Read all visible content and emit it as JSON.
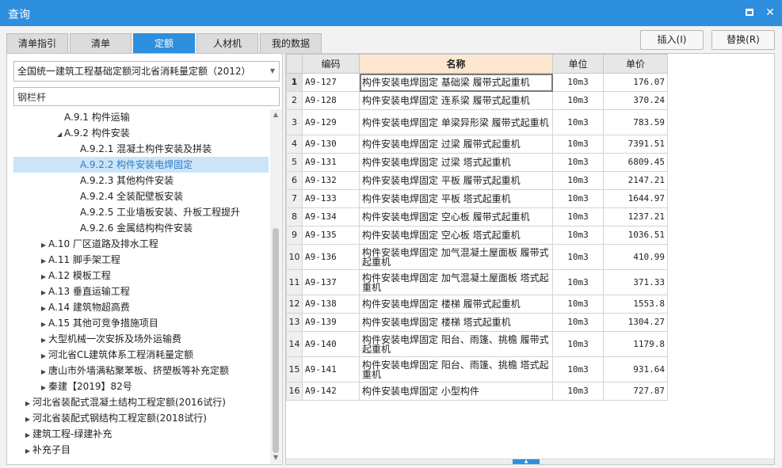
{
  "window": {
    "title": "查询"
  },
  "tabs": [
    {
      "label": "清单指引",
      "active": false
    },
    {
      "label": "清单",
      "active": false
    },
    {
      "label": "定额",
      "active": true
    },
    {
      "label": "人材机",
      "active": false
    },
    {
      "label": "我的数据",
      "active": false
    }
  ],
  "actions": {
    "insert_label": "插入(I)",
    "replace_label": "替换(R)"
  },
  "left": {
    "library_select": "全国统一建筑工程基础定额河北省消耗量定额（2012）",
    "search_value": "钢栏杆",
    "tree": [
      {
        "label": "A.9.1 构件运输",
        "toggle": "",
        "level": 2
      },
      {
        "label": "A.9.2 构件安装",
        "toggle": "◢",
        "level": 2
      },
      {
        "label": "A.9.2.1 混凝土构件安装及拼装",
        "toggle": "",
        "level": 3
      },
      {
        "label": "A.9.2.2 构件安装电焊固定",
        "toggle": "",
        "level": 3,
        "selected": true
      },
      {
        "label": "A.9.2.3 其他构件安装",
        "toggle": "",
        "level": 3
      },
      {
        "label": "A.9.2.4 全装配壁板安装",
        "toggle": "",
        "level": 3
      },
      {
        "label": "A.9.2.5 工业墙板安装、升板工程提升",
        "toggle": "",
        "level": 3
      },
      {
        "label": "A.9.2.6 金属结构构件安装",
        "toggle": "",
        "level": 3
      },
      {
        "label": "A.10 厂区道路及排水工程",
        "toggle": "▶",
        "level": 1
      },
      {
        "label": "A.11 脚手架工程",
        "toggle": "▶",
        "level": 1
      },
      {
        "label": "A.12 模板工程",
        "toggle": "▶",
        "level": 1
      },
      {
        "label": "A.13 垂直运输工程",
        "toggle": "▶",
        "level": 1
      },
      {
        "label": "A.14 建筑物超高费",
        "toggle": "▶",
        "level": 1
      },
      {
        "label": "A.15 其他可竞争措施项目",
        "toggle": "▶",
        "level": 1
      },
      {
        "label": "大型机械一次安拆及场外运输费",
        "toggle": "▶",
        "level": 1
      },
      {
        "label": "河北省CL建筑体系工程消耗量定额",
        "toggle": "▶",
        "level": 1
      },
      {
        "label": "唐山市外墙满粘聚苯板、挤塑板等补充定额",
        "toggle": "▶",
        "level": 1
      },
      {
        "label": "秦建【2019】82号",
        "toggle": "▶",
        "level": 1
      },
      {
        "label": "河北省装配式混凝土结构工程定额(2016试行)",
        "toggle": "▶",
        "level": 0
      },
      {
        "label": "河北省装配式钢结构工程定额(2018试行)",
        "toggle": "▶",
        "level": 0
      },
      {
        "label": "建筑工程-绿建补充",
        "toggle": "▶",
        "level": 0
      },
      {
        "label": "补充子目",
        "toggle": "▶",
        "level": 0
      }
    ]
  },
  "grid": {
    "headers": {
      "code": "编码",
      "name": "名称",
      "unit": "单位",
      "price": "单价"
    },
    "rows": [
      {
        "no": "1",
        "code": "A9-127",
        "name": "构件安装电焊固定 基础梁 履带式起重机",
        "unit": "10m3",
        "price": "176.07"
      },
      {
        "no": "2",
        "code": "A9-128",
        "name": "构件安装电焊固定 连系梁 履带式起重机",
        "unit": "10m3",
        "price": "370.24"
      },
      {
        "no": "3",
        "code": "A9-129",
        "name": "构件安装电焊固定 单梁异形梁 履带式起重机",
        "unit": "10m3",
        "price": "783.59"
      },
      {
        "no": "4",
        "code": "A9-130",
        "name": "构件安装电焊固定 过梁 履带式起重机",
        "unit": "10m3",
        "price": "7391.51"
      },
      {
        "no": "5",
        "code": "A9-131",
        "name": "构件安装电焊固定 过梁 塔式起重机",
        "unit": "10m3",
        "price": "6809.45"
      },
      {
        "no": "6",
        "code": "A9-132",
        "name": "构件安装电焊固定 平板 履带式起重机",
        "unit": "10m3",
        "price": "2147.21"
      },
      {
        "no": "7",
        "code": "A9-133",
        "name": "构件安装电焊固定 平板 塔式起重机",
        "unit": "10m3",
        "price": "1644.97"
      },
      {
        "no": "8",
        "code": "A9-134",
        "name": "构件安装电焊固定 空心板 履带式起重机",
        "unit": "10m3",
        "price": "1237.21"
      },
      {
        "no": "9",
        "code": "A9-135",
        "name": "构件安装电焊固定 空心板 塔式起重机",
        "unit": "10m3",
        "price": "1036.51"
      },
      {
        "no": "10",
        "code": "A9-136",
        "name": "构件安装电焊固定 加气混凝土屋面板 履带式起重机",
        "unit": "10m3",
        "price": "410.99"
      },
      {
        "no": "11",
        "code": "A9-137",
        "name": "构件安装电焊固定 加气混凝土屋面板 塔式起重机",
        "unit": "10m3",
        "price": "371.33"
      },
      {
        "no": "12",
        "code": "A9-138",
        "name": "构件安装电焊固定 楼梯 履带式起重机",
        "unit": "10m3",
        "price": "1553.8"
      },
      {
        "no": "13",
        "code": "A9-139",
        "name": "构件安装电焊固定 楼梯 塔式起重机",
        "unit": "10m3",
        "price": "1304.27"
      },
      {
        "no": "14",
        "code": "A9-140",
        "name": "构件安装电焊固定 阳台、雨篷、挑檐 履带式起重机",
        "unit": "10m3",
        "price": "1179.8"
      },
      {
        "no": "15",
        "code": "A9-141",
        "name": "构件安装电焊固定 阳台、雨篷、挑檐 塔式起重机",
        "unit": "10m3",
        "price": "931.64"
      },
      {
        "no": "16",
        "code": "A9-142",
        "name": "构件安装电焊固定 小型构件",
        "unit": "10m3",
        "price": "727.87"
      }
    ]
  }
}
